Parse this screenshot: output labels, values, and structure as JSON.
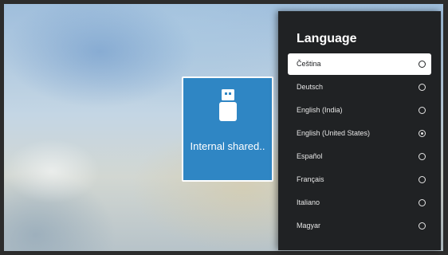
{
  "storage_tile": {
    "label": "Internal shared..",
    "icon": "usb-drive-icon",
    "color": "#2f86c4"
  },
  "language_panel": {
    "title": "Language",
    "items": [
      {
        "label": "Čeština",
        "selected": false,
        "focused": true
      },
      {
        "label": "Deutsch",
        "selected": false,
        "focused": false
      },
      {
        "label": "English (India)",
        "selected": false,
        "focused": false
      },
      {
        "label": "English (United States)",
        "selected": true,
        "focused": false
      },
      {
        "label": "Español",
        "selected": false,
        "focused": false
      },
      {
        "label": "Français",
        "selected": false,
        "focused": false
      },
      {
        "label": "Italiano",
        "selected": false,
        "focused": false
      },
      {
        "label": "Magyar",
        "selected": false,
        "focused": false
      }
    ]
  }
}
